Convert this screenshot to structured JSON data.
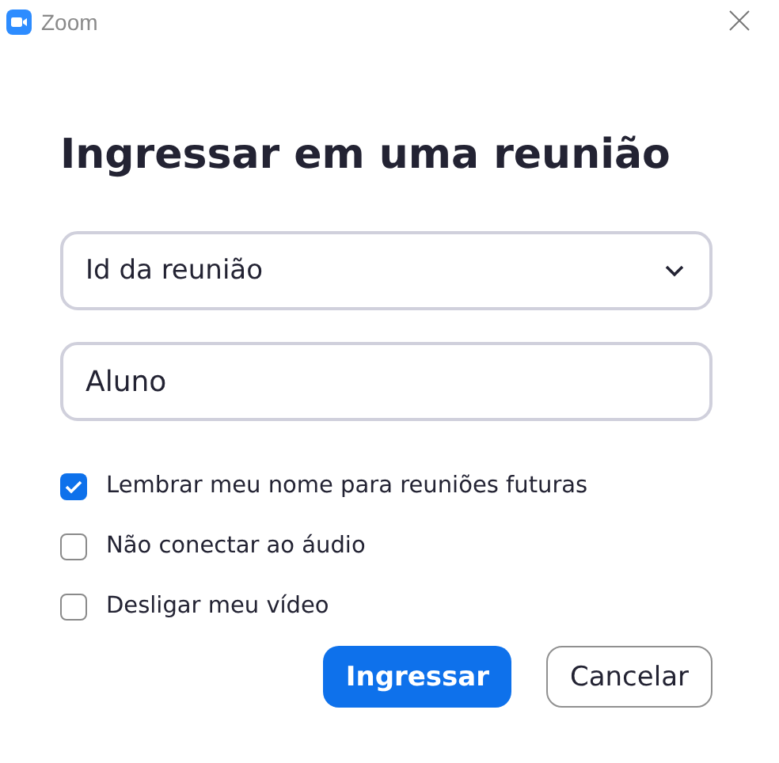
{
  "window": {
    "title": "Zoom"
  },
  "heading": "Ingressar em uma reunião",
  "meeting_id": {
    "value": "Id da reunião"
  },
  "name_field": {
    "value": "Aluno"
  },
  "options": [
    {
      "label": "Lembrar meu nome para reuniões futuras",
      "checked": true
    },
    {
      "label": "Não conectar ao áudio",
      "checked": false
    },
    {
      "label": "Desligar meu vídeo",
      "checked": false
    }
  ],
  "buttons": [
    {
      "label": "Ingressar",
      "kind": "primary"
    },
    {
      "label": "Cancelar",
      "kind": "secondary"
    }
  ]
}
